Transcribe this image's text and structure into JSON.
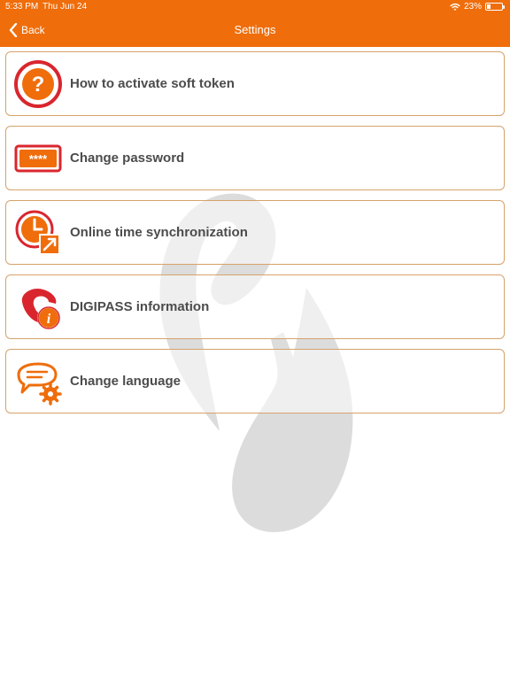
{
  "status": {
    "time": "5:33 PM",
    "date": "Thu Jun 24",
    "battery": "23%",
    "battery_level": 0.23
  },
  "nav": {
    "back_label": "Back",
    "title": "Settings"
  },
  "items": [
    {
      "label": "How to activate soft token",
      "icon": "question-icon"
    },
    {
      "label": "Change password",
      "icon": "password-field-icon"
    },
    {
      "label": "Online time synchronization",
      "icon": "clock-sync-icon"
    },
    {
      "label": "DIGIPASS information",
      "icon": "phone-info-icon"
    },
    {
      "label": "Change language",
      "icon": "speech-gear-icon"
    }
  ],
  "colors": {
    "accent": "#ef6d0b",
    "border": "#d6a26a",
    "text": "#4c4c4c",
    "icon_red": "#d9262e"
  }
}
